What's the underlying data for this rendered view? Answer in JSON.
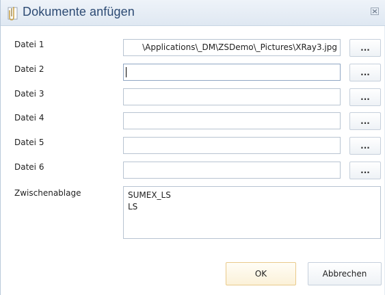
{
  "window": {
    "title": "Dokumente anfügen",
    "icon": "paperclip-icon",
    "close_glyph": "×"
  },
  "rows": [
    {
      "label": "Datei 1",
      "value": "\\Applications\\_DM\\ZSDemo\\_Pictures\\XRay3.jpg",
      "browse_label": "..."
    },
    {
      "label": "Datei 2",
      "value": "",
      "browse_label": "..."
    },
    {
      "label": "Datei 3",
      "value": "",
      "browse_label": "..."
    },
    {
      "label": "Datei 4",
      "value": "",
      "browse_label": "..."
    },
    {
      "label": "Datei 5",
      "value": "",
      "browse_label": "..."
    },
    {
      "label": "Datei 6",
      "value": "",
      "browse_label": "..."
    }
  ],
  "clipboard": {
    "label": "Zwischenablage",
    "line1": "SUMEX_LS",
    "line2": "LS"
  },
  "buttons": {
    "ok": "OK",
    "cancel": "Abbrechen"
  },
  "colors": {
    "title_text": "#2c4a73",
    "ok_border": "#e9c98a"
  }
}
